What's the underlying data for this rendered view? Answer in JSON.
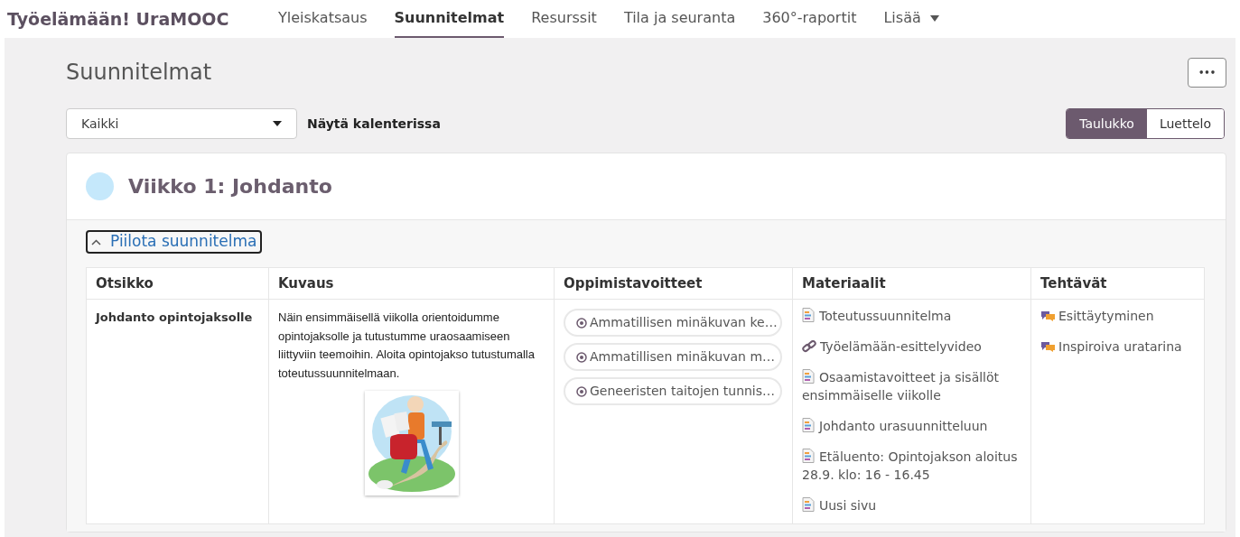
{
  "brand": "Työelämään! UraMOOC",
  "nav": [
    {
      "label": "Yleiskatsaus",
      "selected": false
    },
    {
      "label": "Suunnitelmat",
      "selected": true
    },
    {
      "label": "Resurssit",
      "selected": false
    },
    {
      "label": "Tila ja seuranta",
      "selected": false
    },
    {
      "label": "360°-raportit",
      "selected": false
    },
    {
      "label": "Lisää",
      "selected": false,
      "kind": "dropdown"
    }
  ],
  "page_title": "Suunnitelmat",
  "more_button": "•••",
  "filter": {
    "value": "Kaikki"
  },
  "calendar_link": "Näytä kalenterissa",
  "view_toggle": [
    {
      "label": "Taulukko",
      "selected": true
    },
    {
      "label": "Luettelo",
      "selected": false
    }
  ],
  "plan": {
    "title": "Viikko 1: Johdanto",
    "toggle": "Piilota suunnitelma",
    "expanded": true,
    "columns": [
      "Otsikko",
      "Kuvaus",
      "Oppimistavoitteet",
      "Materiaalit",
      "Tehtävät"
    ],
    "row": {
      "title": "Johdanto opintojaksolle",
      "description": "Näin ensimmäisellä viikolla orientoidumme opintojaksolle ja tutustumme uraosaamiseen liittyviin teemoihin. Aloita opintojakso tutustumalla toteutussuunnitelmaan.",
      "image": {
        "kind": "picture"
      },
      "goals": [
        "Ammatillisen minäkuvan ke…",
        "Ammatillisen minäkuvan m…",
        "Geneeristen taitojen tunnis…"
      ],
      "materials": [
        {
          "kind": "page",
          "label": "Toteutussuunnitelma"
        },
        {
          "kind": "link",
          "label": "Työelämään-esittelyvideo"
        },
        {
          "kind": "page",
          "label": "Osaamistavoitteet ja sisällöt ensimmäiselle viikolle"
        },
        {
          "kind": "page",
          "label": "Johdanto urasuunnitteluun"
        },
        {
          "kind": "page",
          "label": "Etäluento: Opintojakson aloitus 28.9. klo: 16 - 16.45"
        },
        {
          "kind": "page",
          "label": "Uusi sivu"
        }
      ],
      "tasks": [
        "Esittäytyminen",
        "Inspiroiva uratarina"
      ]
    }
  }
}
